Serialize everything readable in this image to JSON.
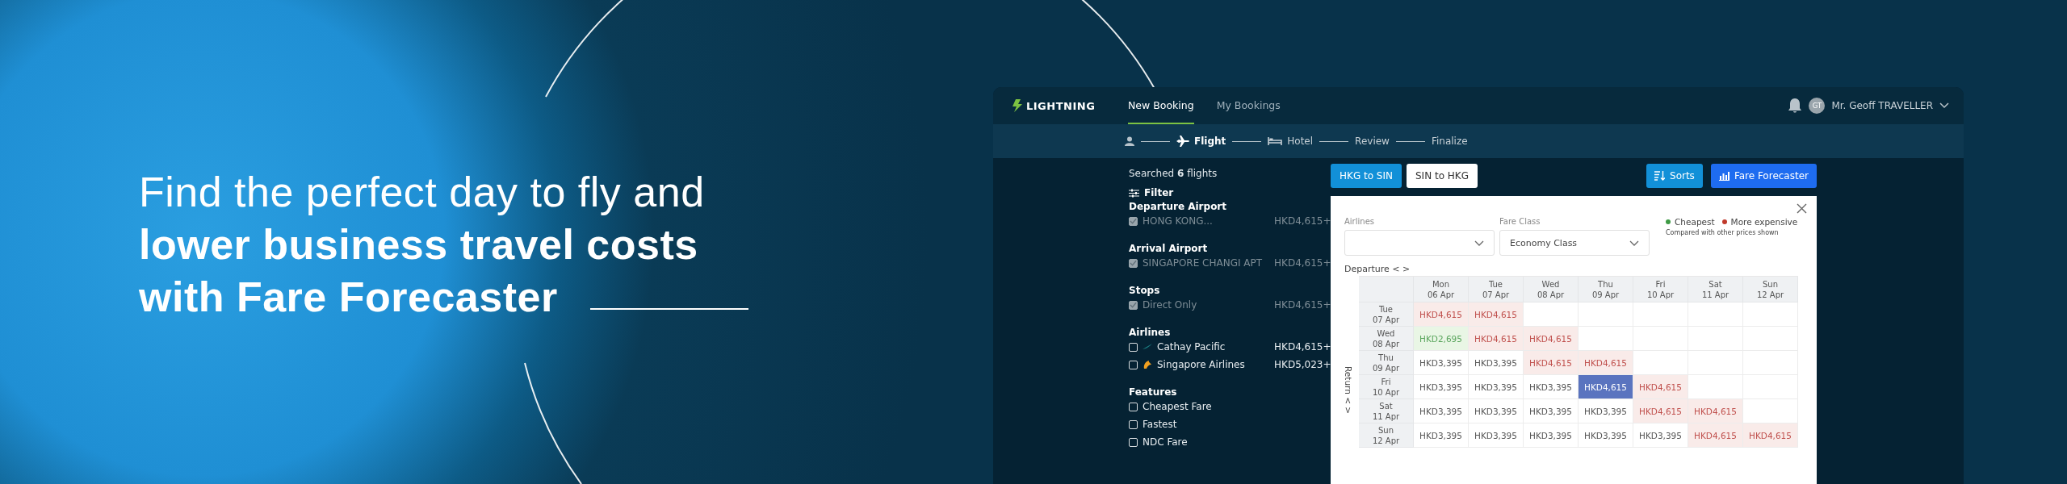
{
  "headline": {
    "lines": [
      {
        "text": "Find the perfect day to fly and",
        "bold": false
      },
      {
        "text": "lower business travel costs",
        "bold": true
      },
      {
        "text": "with Fare Forecaster",
        "bold": true
      }
    ]
  },
  "app": {
    "logo": "LIGHTNING",
    "nav": [
      {
        "label": "New Booking",
        "selected": true
      },
      {
        "label": "My Bookings",
        "selected": false
      }
    ],
    "user": {
      "initials": "GT",
      "name": "Mr. Geoff TRAVELLER"
    },
    "steps": [
      {
        "kind": "person",
        "selected": false
      },
      {
        "kind": "plane",
        "label": "Flight",
        "selected": true
      },
      {
        "kind": "bed",
        "label": "Hotel",
        "selected": false
      },
      {
        "kind": "text",
        "label": "Review",
        "selected": false
      },
      {
        "kind": "text",
        "label": "Finalize",
        "selected": false
      }
    ],
    "sidebar": {
      "summary": "Searched **6** flights",
      "filter_title": "Filter",
      "sections": [
        {
          "title": "Departure Airport",
          "options": [
            {
              "label": "HONG KONG...",
              "price": "HKD4,615+",
              "checked": true,
              "disabled": true,
              "kind": "plain"
            }
          ]
        },
        {
          "title": "Arrival Airport",
          "options": [
            {
              "label": "SINGAPORE CHANGI APT",
              "price": "HKD4,615+",
              "checked": true,
              "disabled": true,
              "kind": "plain"
            }
          ]
        },
        {
          "title": "Stops",
          "options": [
            {
              "label": "Direct Only",
              "price": "HKD4,615+",
              "checked": true,
              "disabled": true,
              "kind": "plain"
            }
          ]
        },
        {
          "title": "Airlines",
          "options": [
            {
              "label": "Cathay Pacific",
              "price": "HKD4,615+",
              "checked": false,
              "disabled": false,
              "kind": "brushstroke"
            },
            {
              "label": "Singapore Airlines",
              "price": "HKD5,023+",
              "checked": false,
              "disabled": false,
              "kind": "bird"
            }
          ]
        },
        {
          "title": "Features",
          "options": [
            {
              "label": "Cheapest Fare",
              "checked": false,
              "disabled": false,
              "kind": "plain"
            },
            {
              "label": "Fastest",
              "checked": false,
              "disabled": false,
              "kind": "plain"
            },
            {
              "label": "NDC Fare",
              "checked": false,
              "disabled": false,
              "kind": "plain"
            }
          ]
        }
      ]
    },
    "direction_tabs": [
      {
        "label": "HKG to SIN",
        "selected": true
      },
      {
        "label": "SIN to HKG",
        "selected": false
      }
    ],
    "actions": [
      {
        "label": "Sorts",
        "kind": "sorts",
        "selected": false
      },
      {
        "label": "Fare Forecaster",
        "kind": "chart",
        "selected": true
      }
    ],
    "forecaster": {
      "airlines_label": "Airlines",
      "fare_class_label": "Fare Class",
      "fare_class": "Economy Class",
      "legend": [
        {
          "label": "Cheapest",
          "color": "#3e9a45"
        },
        {
          "label": "More expensive",
          "color": "#c0392b"
        }
      ],
      "legend_note": "Compared with other prices shown",
      "departure_label": "Departure < >",
      "return_label": "Return < >",
      "columns": [
        {
          "day": "Mon",
          "date": "06 Apr"
        },
        {
          "day": "Tue",
          "date": "07 Apr"
        },
        {
          "day": "Wed",
          "date": "08 Apr"
        },
        {
          "day": "Thu",
          "date": "09 Apr"
        },
        {
          "day": "Fri",
          "date": "10 Apr"
        },
        {
          "day": "Sat",
          "date": "11 Apr"
        },
        {
          "day": "Sun",
          "date": "12 Apr"
        }
      ],
      "rows": [
        {
          "day": "Tue",
          "date": "07 Apr",
          "cells": [
            {
              "kind": "expensive",
              "price": "HKD4,615"
            },
            {
              "kind": "expensive",
              "price": "HKD4,615"
            },
            {
              "kind": "empty"
            },
            {
              "kind": "empty"
            },
            {
              "kind": "empty"
            },
            {
              "kind": "empty"
            },
            {
              "kind": "empty"
            }
          ]
        },
        {
          "day": "Wed",
          "date": "08 Apr",
          "cells": [
            {
              "kind": "cheapest",
              "price": "HKD2,695"
            },
            {
              "kind": "expensive",
              "price": "HKD4,615"
            },
            {
              "kind": "expensive",
              "price": "HKD4,615"
            },
            {
              "kind": "empty"
            },
            {
              "kind": "empty"
            },
            {
              "kind": "empty"
            },
            {
              "kind": "empty"
            }
          ]
        },
        {
          "day": "Thu",
          "date": "09 Apr",
          "cells": [
            {
              "kind": "normal",
              "price": "HKD3,395"
            },
            {
              "kind": "normal",
              "price": "HKD3,395"
            },
            {
              "kind": "expensive",
              "price": "HKD4,615"
            },
            {
              "kind": "expensive",
              "price": "HKD4,615"
            },
            {
              "kind": "empty"
            },
            {
              "kind": "empty"
            },
            {
              "kind": "empty"
            }
          ]
        },
        {
          "day": "Fri",
          "date": "10 Apr",
          "cells": [
            {
              "kind": "normal",
              "price": "HKD3,395"
            },
            {
              "kind": "normal",
              "price": "HKD3,395"
            },
            {
              "kind": "normal",
              "price": "HKD3,395"
            },
            {
              "kind": "selected",
              "price": "HKD4,615"
            },
            {
              "kind": "expensive",
              "price": "HKD4,615"
            },
            {
              "kind": "empty"
            },
            {
              "kind": "empty"
            }
          ]
        },
        {
          "day": "Sat",
          "date": "11 Apr",
          "cells": [
            {
              "kind": "normal",
              "price": "HKD3,395"
            },
            {
              "kind": "normal",
              "price": "HKD3,395"
            },
            {
              "kind": "normal",
              "price": "HKD3,395"
            },
            {
              "kind": "normal",
              "price": "HKD3,395"
            },
            {
              "kind": "expensive",
              "price": "HKD4,615"
            },
            {
              "kind": "expensive",
              "price": "HKD4,615"
            },
            {
              "kind": "empty"
            }
          ]
        },
        {
          "day": "Sun",
          "date": "12 Apr",
          "cells": [
            {
              "kind": "normal",
              "price": "HKD3,395"
            },
            {
              "kind": "normal",
              "price": "HKD3,395"
            },
            {
              "kind": "normal",
              "price": "HKD3,395"
            },
            {
              "kind": "normal",
              "price": "HKD3,395"
            },
            {
              "kind": "normal",
              "price": "HKD3,395"
            },
            {
              "kind": "expensive",
              "price": "HKD4,615"
            },
            {
              "kind": "expensive",
              "price": "HKD4,615"
            }
          ]
        }
      ]
    }
  }
}
